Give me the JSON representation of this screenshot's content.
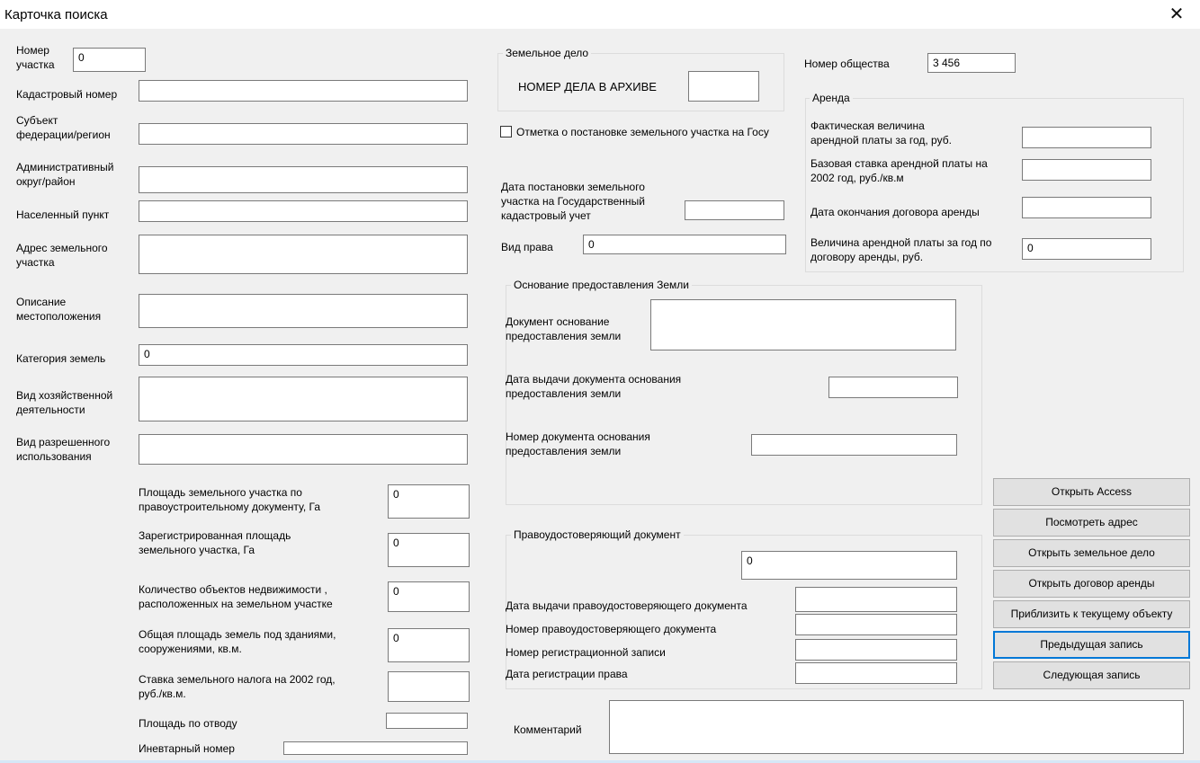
{
  "window": {
    "title": "Карточка поиска",
    "close_glyph": "✕"
  },
  "left": {
    "plot_number_label": "Номер\nучастка",
    "plot_number_value": "0",
    "cadastral_label": "Кадастровый номер",
    "cadastral_value": "",
    "subject_label": "Субъект\nфедерации/регион",
    "subject_value": "",
    "admin_label": "Административный\nокруг/район",
    "admin_value": "",
    "locality_label": "Населенный пункт",
    "locality_value": "",
    "address_label": "Адрес земельного\nучастка",
    "address_value": "",
    "location_desc_label": "Описание\nместоположения",
    "location_desc_value": "",
    "land_category_label": "Категория земель",
    "land_category_value": "0",
    "activity_label": "Вид хозяйственной\nдеятельности",
    "activity_value": "",
    "permitted_use_label": "Вид разрешенного\nиспользования",
    "permitted_use_value": ""
  },
  "areas": {
    "area_doc_label": "Площадь земельного участка по\nправоустроительному документу, Га",
    "area_doc_value": "0",
    "reg_area_label": "Зарегистрированная площадь\nземельного участка, Га",
    "reg_area_value": "0",
    "objects_count_label": "Количество объектов недвижимости ,\nрасположенных на земельном участке",
    "objects_count_value": "0",
    "built_area_label": "Общая площадь земель под зданиями,\nсооружениями, кв.м.",
    "built_area_value": "0",
    "tax_rate_label": "Ставка земельного налога на 2002 год,\nруб./кв.м.",
    "tax_rate_value": "",
    "allotted_area_label": "Площадь по отводу",
    "allotted_area_value": "",
    "inventory_label": "Иневтарный номер",
    "inventory_value": ""
  },
  "land_case": {
    "group_title": "Земельное дело",
    "archive_label": "НОМЕР ДЕЛА В АРХИВЕ",
    "archive_value": "",
    "checkbox_label": "Отметка о постановке земельного участка на Госу",
    "checkbox_checked": false,
    "reg_date_label": "Дата постановки земельного\nучастка на Государственный\nкадастровый учет",
    "reg_date_value": "",
    "right_type_label": "Вид права",
    "right_type_value": "0"
  },
  "society": {
    "label": "Номер общества",
    "value": "3 456"
  },
  "lease": {
    "group_title": "Аренда",
    "actual_label": "Фактическая величина\nарендной платы за год, руб.",
    "actual_value": "",
    "base_rate_label": "Базовая ставка арендной платы на\n2002 год, руб./кв.м",
    "base_rate_value": "",
    "end_date_label": "Дата окончания договора аренды",
    "end_date_value": "",
    "annual_label": "Величина арендной платы за год по\nдоговору аренды, руб.",
    "annual_value": "0"
  },
  "basis": {
    "group_title": "Основание предоставления Земли",
    "doc_label": "Документ основание\nпредоставления земли",
    "doc_value": "",
    "issue_date_label": "Дата выдачи документа  основания\nпредоставления земли",
    "issue_date_value": "",
    "doc_number_label": "Номер документа основания\nпредоставления земли",
    "doc_number_value": ""
  },
  "title_doc": {
    "group_title": "Правоудостоверяющий документ",
    "main_value": "0",
    "issue_date_label": "Дата выдачи правоудостоверяющего документа",
    "issue_date_value": "",
    "number_label": "Номер правоудостоверяющего документа",
    "number_value": "",
    "reg_record_label": "Номер регистрационной записи",
    "reg_record_value": "",
    "reg_date_label": "Дата регистрации права",
    "reg_date_value": ""
  },
  "comment": {
    "label": "Комментарий",
    "value": ""
  },
  "buttons": {
    "open_access": "Открыть Access",
    "view_address": "Посмотреть адрес",
    "open_land_case": "Открыть земельное дело",
    "open_lease": "Открыть договор аренды",
    "zoom_to_object": "Приблизить к текущему объекту",
    "prev_record": "Предыдущая запись",
    "next_record": "Следующая запись"
  }
}
